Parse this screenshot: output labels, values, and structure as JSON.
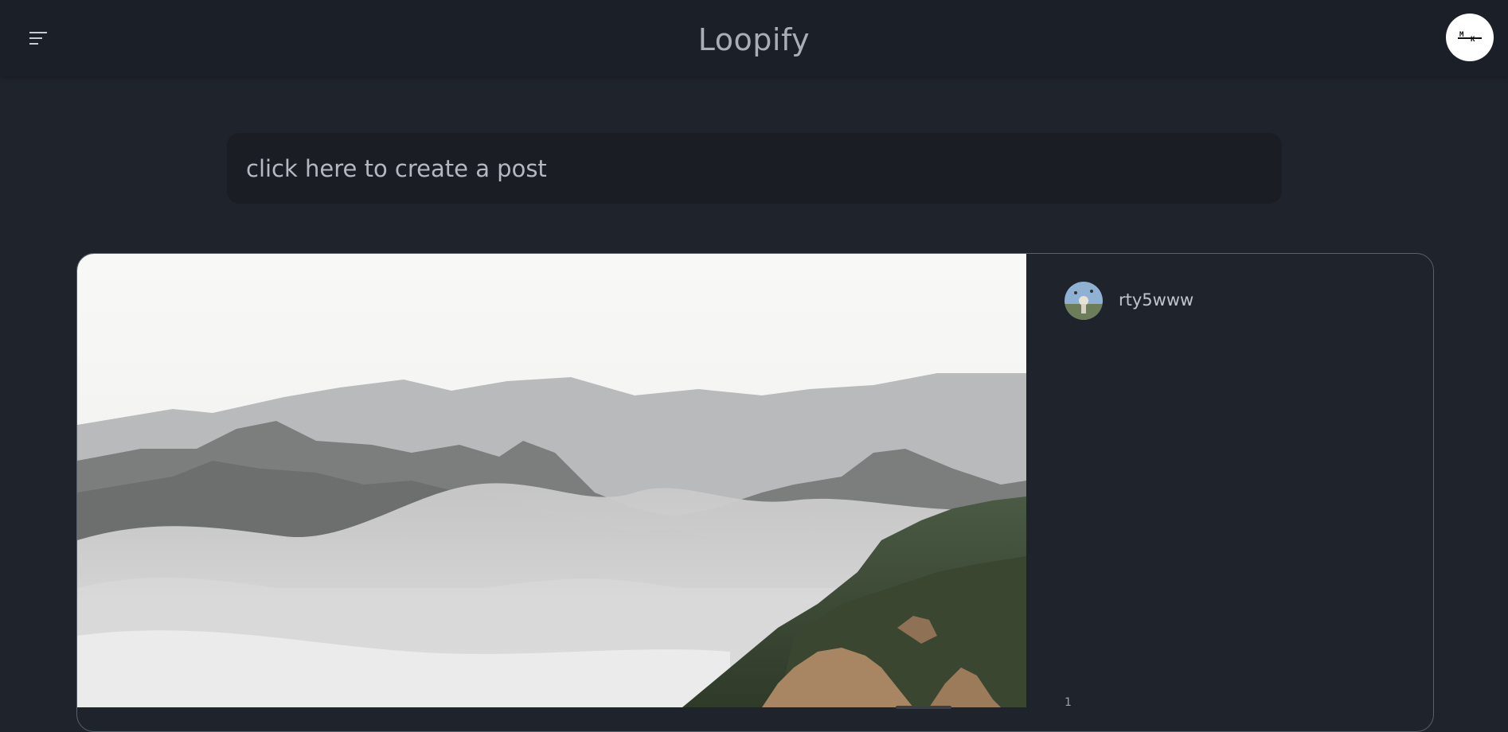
{
  "header": {
    "title": "Loopify",
    "menu_icon": "hamburger-menu-icon",
    "profile_logo_top": "M",
    "profile_logo_bottom": "K"
  },
  "composer": {
    "placeholder": "click here to create a post"
  },
  "post": {
    "author": "rty5www",
    "like_count": "1",
    "image_description_icon": "mountain-landscape-image"
  },
  "colors": {
    "background": "#1f232b",
    "topbar": "#1b1f27",
    "composer": "#1a1d23",
    "title_text": "#a9adb6"
  }
}
